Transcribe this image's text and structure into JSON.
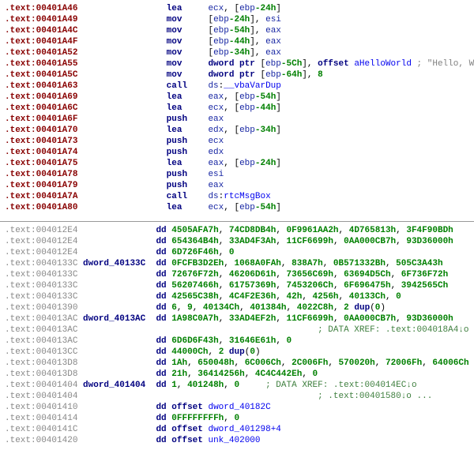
{
  "top": {
    "rows": [
      {
        "addr": ".text:00401A46",
        "mnem": "lea",
        "ops": [
          {
            "t": "reg",
            "v": "ecx"
          },
          {
            "t": "plain",
            "v": ", ["
          },
          {
            "t": "reg",
            "v": "ebp"
          },
          {
            "t": "num",
            "v": "-24h"
          },
          {
            "t": "plain",
            "v": "]"
          }
        ]
      },
      {
        "addr": ".text:00401A49",
        "mnem": "mov",
        "ops": [
          {
            "t": "plain",
            "v": "["
          },
          {
            "t": "reg",
            "v": "ebp"
          },
          {
            "t": "num",
            "v": "-24h"
          },
          {
            "t": "plain",
            "v": "], "
          },
          {
            "t": "reg",
            "v": "esi"
          }
        ]
      },
      {
        "addr": ".text:00401A4C",
        "mnem": "mov",
        "ops": [
          {
            "t": "plain",
            "v": "["
          },
          {
            "t": "reg",
            "v": "ebp"
          },
          {
            "t": "num",
            "v": "-54h"
          },
          {
            "t": "plain",
            "v": "], "
          },
          {
            "t": "reg",
            "v": "eax"
          }
        ]
      },
      {
        "addr": ".text:00401A4F",
        "mnem": "mov",
        "ops": [
          {
            "t": "plain",
            "v": "["
          },
          {
            "t": "reg",
            "v": "ebp"
          },
          {
            "t": "num",
            "v": "-44h"
          },
          {
            "t": "plain",
            "v": "], "
          },
          {
            "t": "reg",
            "v": "eax"
          }
        ]
      },
      {
        "addr": ".text:00401A52",
        "mnem": "mov",
        "ops": [
          {
            "t": "plain",
            "v": "["
          },
          {
            "t": "reg",
            "v": "ebp"
          },
          {
            "t": "num",
            "v": "-34h"
          },
          {
            "t": "plain",
            "v": "], "
          },
          {
            "t": "reg",
            "v": "eax"
          }
        ]
      },
      {
        "addr": ".text:00401A55",
        "mnem": "mov",
        "ops": [
          {
            "t": "kw",
            "v": "dword ptr "
          },
          {
            "t": "plain",
            "v": "["
          },
          {
            "t": "reg",
            "v": "ebp"
          },
          {
            "t": "num",
            "v": "-5Ch"
          },
          {
            "t": "plain",
            "v": "], "
          },
          {
            "t": "kw",
            "v": "offset "
          },
          {
            "t": "sym",
            "v": "aHelloWorld"
          }
        ],
        "comment": " ; \"Hello, World!\""
      },
      {
        "addr": ".text:00401A5C",
        "mnem": "mov",
        "ops": [
          {
            "t": "kw",
            "v": "dword ptr "
          },
          {
            "t": "plain",
            "v": "["
          },
          {
            "t": "reg",
            "v": "ebp"
          },
          {
            "t": "num",
            "v": "-64h"
          },
          {
            "t": "plain",
            "v": "], "
          },
          {
            "t": "num",
            "v": "8"
          }
        ]
      },
      {
        "addr": ".text:00401A63",
        "mnem": "call",
        "ops": [
          {
            "t": "reg",
            "v": "ds"
          },
          {
            "t": "plain",
            "v": ":"
          },
          {
            "t": "sym",
            "v": "__vbaVarDup"
          }
        ]
      },
      {
        "addr": ".text:00401A69",
        "mnem": "lea",
        "ops": [
          {
            "t": "reg",
            "v": "eax"
          },
          {
            "t": "plain",
            "v": ", ["
          },
          {
            "t": "reg",
            "v": "ebp"
          },
          {
            "t": "num",
            "v": "-54h"
          },
          {
            "t": "plain",
            "v": "]"
          }
        ]
      },
      {
        "addr": ".text:00401A6C",
        "mnem": "lea",
        "ops": [
          {
            "t": "reg",
            "v": "ecx"
          },
          {
            "t": "plain",
            "v": ", ["
          },
          {
            "t": "reg",
            "v": "ebp"
          },
          {
            "t": "num",
            "v": "-44h"
          },
          {
            "t": "plain",
            "v": "]"
          }
        ]
      },
      {
        "addr": ".text:00401A6F",
        "mnem": "push",
        "ops": [
          {
            "t": "reg",
            "v": "eax"
          }
        ]
      },
      {
        "addr": ".text:00401A70",
        "mnem": "lea",
        "ops": [
          {
            "t": "reg",
            "v": "edx"
          },
          {
            "t": "plain",
            "v": ", ["
          },
          {
            "t": "reg",
            "v": "ebp"
          },
          {
            "t": "num",
            "v": "-34h"
          },
          {
            "t": "plain",
            "v": "]"
          }
        ]
      },
      {
        "addr": ".text:00401A73",
        "mnem": "push",
        "ops": [
          {
            "t": "reg",
            "v": "ecx"
          }
        ]
      },
      {
        "addr": ".text:00401A74",
        "mnem": "push",
        "ops": [
          {
            "t": "reg",
            "v": "edx"
          }
        ]
      },
      {
        "addr": ".text:00401A75",
        "mnem": "lea",
        "ops": [
          {
            "t": "reg",
            "v": "eax"
          },
          {
            "t": "plain",
            "v": ", ["
          },
          {
            "t": "reg",
            "v": "ebp"
          },
          {
            "t": "num",
            "v": "-24h"
          },
          {
            "t": "plain",
            "v": "]"
          }
        ]
      },
      {
        "addr": ".text:00401A78",
        "mnem": "push",
        "ops": [
          {
            "t": "reg",
            "v": "esi"
          }
        ]
      },
      {
        "addr": ".text:00401A79",
        "mnem": "push",
        "ops": [
          {
            "t": "reg",
            "v": "eax"
          }
        ]
      },
      {
        "addr": ".text:00401A7A",
        "mnem": "call",
        "ops": [
          {
            "t": "reg",
            "v": "ds"
          },
          {
            "t": "plain",
            "v": ":"
          },
          {
            "t": "sym",
            "v": "rtcMsgBox"
          }
        ]
      },
      {
        "addr": ".text:00401A80",
        "mnem": "lea",
        "ops": [
          {
            "t": "reg",
            "v": "ecx"
          },
          {
            "t": "plain",
            "v": ", ["
          },
          {
            "t": "reg",
            "v": "ebp"
          },
          {
            "t": "num",
            "v": "-54h"
          },
          {
            "t": "plain",
            "v": "]"
          }
        ]
      }
    ]
  },
  "bottom": {
    "rows": [
      {
        "addr": ".text:004012E4",
        "label": "",
        "kw": "dd",
        "rest": [
          {
            "t": "num",
            "v": "4505AFA7h"
          },
          {
            "t": "plain",
            "v": ", "
          },
          {
            "t": "num",
            "v": "74CD8DB4h"
          },
          {
            "t": "plain",
            "v": ", "
          },
          {
            "t": "num",
            "v": "0F9961AA2h"
          },
          {
            "t": "plain",
            "v": ", "
          },
          {
            "t": "num",
            "v": "4D765813h"
          },
          {
            "t": "plain",
            "v": ", "
          },
          {
            "t": "num",
            "v": "3F4F90BDh"
          }
        ]
      },
      {
        "addr": ".text:004012E4",
        "label": "",
        "kw": "dd",
        "rest": [
          {
            "t": "num",
            "v": "654364B4h"
          },
          {
            "t": "plain",
            "v": ", "
          },
          {
            "t": "num",
            "v": "33AD4F3Ah"
          },
          {
            "t": "plain",
            "v": ", "
          },
          {
            "t": "num",
            "v": "11CF6699h"
          },
          {
            "t": "plain",
            "v": ", "
          },
          {
            "t": "num",
            "v": "0AA000CB7h"
          },
          {
            "t": "plain",
            "v": ", "
          },
          {
            "t": "num",
            "v": "93D36000h"
          }
        ]
      },
      {
        "addr": ".text:004012E4",
        "label": "",
        "kw": "dd",
        "rest": [
          {
            "t": "num",
            "v": "6D726F46h"
          },
          {
            "t": "plain",
            "v": ", "
          },
          {
            "t": "num",
            "v": "0"
          }
        ]
      },
      {
        "addr": ".text:0040133C",
        "label": "dword_40133C",
        "kw": "dd",
        "rest": [
          {
            "t": "num",
            "v": "0FCFB3D2Eh"
          },
          {
            "t": "plain",
            "v": ", "
          },
          {
            "t": "num",
            "v": "1068A0FAh"
          },
          {
            "t": "plain",
            "v": ", "
          },
          {
            "t": "num",
            "v": "838A7h"
          },
          {
            "t": "plain",
            "v": ", "
          },
          {
            "t": "num",
            "v": "0B571332Bh"
          },
          {
            "t": "plain",
            "v": ", "
          },
          {
            "t": "num",
            "v": "505C3A43h"
          }
        ]
      },
      {
        "addr": ".text:0040133C",
        "label": "",
        "kw": "dd",
        "rest": [
          {
            "t": "num",
            "v": "72676F72h"
          },
          {
            "t": "plain",
            "v": ", "
          },
          {
            "t": "num",
            "v": "46206D61h"
          },
          {
            "t": "plain",
            "v": ", "
          },
          {
            "t": "num",
            "v": "73656C69h"
          },
          {
            "t": "plain",
            "v": ", "
          },
          {
            "t": "num",
            "v": "63694D5Ch"
          },
          {
            "t": "plain",
            "v": ", "
          },
          {
            "t": "num",
            "v": "6F736F72h"
          }
        ]
      },
      {
        "addr": ".text:0040133C",
        "label": "",
        "kw": "dd",
        "rest": [
          {
            "t": "num",
            "v": "56207466h"
          },
          {
            "t": "plain",
            "v": ", "
          },
          {
            "t": "num",
            "v": "61757369h"
          },
          {
            "t": "plain",
            "v": ", "
          },
          {
            "t": "num",
            "v": "7453206Ch"
          },
          {
            "t": "plain",
            "v": ", "
          },
          {
            "t": "num",
            "v": "6F696475h"
          },
          {
            "t": "plain",
            "v": ", "
          },
          {
            "t": "num",
            "v": "3942565Ch"
          }
        ]
      },
      {
        "addr": ".text:0040133C",
        "label": "",
        "kw": "dd",
        "rest": [
          {
            "t": "num",
            "v": "42565C38h"
          },
          {
            "t": "plain",
            "v": ", "
          },
          {
            "t": "num",
            "v": "4C4F2E36h"
          },
          {
            "t": "plain",
            "v": ", "
          },
          {
            "t": "num",
            "v": "42h"
          },
          {
            "t": "plain",
            "v": ", "
          },
          {
            "t": "num",
            "v": "4256h"
          },
          {
            "t": "plain",
            "v": ", "
          },
          {
            "t": "num",
            "v": "40133Ch"
          },
          {
            "t": "plain",
            "v": ", "
          },
          {
            "t": "num",
            "v": "0"
          }
        ]
      },
      {
        "addr": ".text:00401390",
        "label": "",
        "kw": "dd",
        "rest": [
          {
            "t": "num",
            "v": "6"
          },
          {
            "t": "plain",
            "v": ", "
          },
          {
            "t": "num",
            "v": "9"
          },
          {
            "t": "plain",
            "v": ", "
          },
          {
            "t": "num",
            "v": "40134Ch"
          },
          {
            "t": "plain",
            "v": ", "
          },
          {
            "t": "num",
            "v": "401384h"
          },
          {
            "t": "plain",
            "v": ", "
          },
          {
            "t": "num",
            "v": "4022C8h"
          },
          {
            "t": "plain",
            "v": ", "
          },
          {
            "t": "num",
            "v": "2"
          },
          {
            "t": "plain",
            "v": " "
          },
          {
            "t": "kw",
            "v": "dup"
          },
          {
            "t": "plain",
            "v": "("
          },
          {
            "t": "num",
            "v": "0"
          },
          {
            "t": "plain",
            "v": ")"
          }
        ]
      },
      {
        "addr": ".text:004013AC",
        "label": "dword_4013AC",
        "kw": "dd",
        "rest": [
          {
            "t": "num",
            "v": "1A98C0A7h"
          },
          {
            "t": "plain",
            "v": ", "
          },
          {
            "t": "num",
            "v": "33AD4EF2h"
          },
          {
            "t": "plain",
            "v": ", "
          },
          {
            "t": "num",
            "v": "11CF6699h"
          },
          {
            "t": "plain",
            "v": ", "
          },
          {
            "t": "num",
            "v": "0AA000CB7h"
          },
          {
            "t": "plain",
            "v": ", "
          },
          {
            "t": "num",
            "v": "93D36000h"
          }
        ]
      },
      {
        "addr": ".text:004013AC",
        "label": "",
        "kw": "",
        "rest": [
          {
            "t": "xref",
            "v": "; DATA XREF: .text:004018A4↓o"
          }
        ],
        "indentExtra": true
      },
      {
        "addr": ".text:004013AC",
        "label": "",
        "kw": "dd",
        "rest": [
          {
            "t": "num",
            "v": "6D6D6F43h"
          },
          {
            "t": "plain",
            "v": ", "
          },
          {
            "t": "num",
            "v": "31646E61h"
          },
          {
            "t": "plain",
            "v": ", "
          },
          {
            "t": "num",
            "v": "0"
          }
        ]
      },
      {
        "addr": ".text:004013CC",
        "label": "",
        "kw": "dd",
        "rest": [
          {
            "t": "num",
            "v": "44000Ch"
          },
          {
            "t": "plain",
            "v": ", "
          },
          {
            "t": "num",
            "v": "2"
          },
          {
            "t": "plain",
            "v": " "
          },
          {
            "t": "kw",
            "v": "dup"
          },
          {
            "t": "plain",
            "v": "("
          },
          {
            "t": "num",
            "v": "0"
          },
          {
            "t": "plain",
            "v": ")"
          }
        ]
      },
      {
        "addr": ".text:004013D8",
        "label": "",
        "kw": "dd",
        "rest": [
          {
            "t": "num",
            "v": "1Ah"
          },
          {
            "t": "plain",
            "v": ", "
          },
          {
            "t": "num",
            "v": "650048h"
          },
          {
            "t": "plain",
            "v": ", "
          },
          {
            "t": "num",
            "v": "6C006Ch"
          },
          {
            "t": "plain",
            "v": ", "
          },
          {
            "t": "num",
            "v": "2C006Fh"
          },
          {
            "t": "plain",
            "v": ", "
          },
          {
            "t": "num",
            "v": "570020h"
          },
          {
            "t": "plain",
            "v": ", "
          },
          {
            "t": "num",
            "v": "72006Fh"
          },
          {
            "t": "plain",
            "v": ", "
          },
          {
            "t": "num",
            "v": "64006Ch"
          }
        ]
      },
      {
        "addr": ".text:004013D8",
        "label": "",
        "kw": "dd",
        "rest": [
          {
            "t": "num",
            "v": "21h"
          },
          {
            "t": "plain",
            "v": ", "
          },
          {
            "t": "num",
            "v": "36414256h"
          },
          {
            "t": "plain",
            "v": ", "
          },
          {
            "t": "num",
            "v": "4C4C442Eh"
          },
          {
            "t": "plain",
            "v": ", "
          },
          {
            "t": "num",
            "v": "0"
          }
        ]
      },
      {
        "addr": ".text:00401404",
        "label": "dword_401404",
        "kw": "dd",
        "rest": [
          {
            "t": "num",
            "v": "1"
          },
          {
            "t": "plain",
            "v": ", "
          },
          {
            "t": "num",
            "v": "401248h"
          },
          {
            "t": "plain",
            "v": ", "
          },
          {
            "t": "num",
            "v": "0     "
          },
          {
            "t": "xref",
            "v": "; DATA XREF: .text:004014EC↓o"
          }
        ]
      },
      {
        "addr": ".text:00401404",
        "label": "",
        "kw": "",
        "rest": [
          {
            "t": "xref",
            "v": "; .text:00401580↓o ..."
          }
        ],
        "indentExtra": true
      },
      {
        "addr": ".text:00401410",
        "label": "",
        "kw": "dd",
        "rest": [
          {
            "t": "kw",
            "v": "offset "
          },
          {
            "t": "sym",
            "v": "dword_40182C"
          }
        ]
      },
      {
        "addr": ".text:00401414",
        "label": "",
        "kw": "dd",
        "rest": [
          {
            "t": "num",
            "v": "0FFFFFFFFh"
          },
          {
            "t": "plain",
            "v": ", "
          },
          {
            "t": "num",
            "v": "0"
          }
        ]
      },
      {
        "addr": ".text:0040141C",
        "label": "",
        "kw": "dd",
        "rest": [
          {
            "t": "kw",
            "v": "offset "
          },
          {
            "t": "sym",
            "v": "dword_401298+4"
          }
        ]
      },
      {
        "addr": ".text:00401420",
        "label": "",
        "kw": "dd",
        "rest": [
          {
            "t": "kw",
            "v": "offset "
          },
          {
            "t": "sym",
            "v": "unk_402000"
          }
        ]
      }
    ]
  }
}
